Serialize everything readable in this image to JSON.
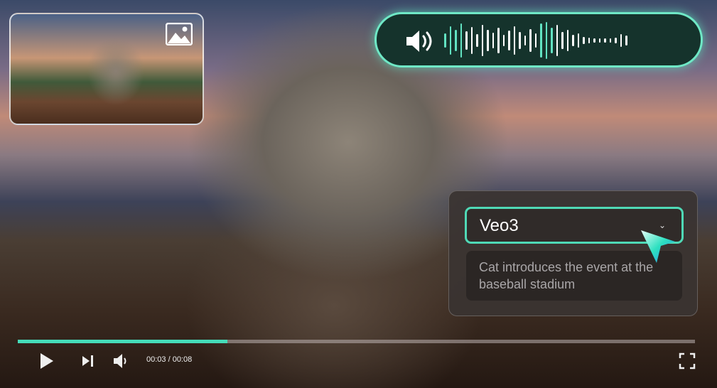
{
  "thumbnail": {
    "icon": "image-icon"
  },
  "audio": {
    "icon": "speaker-icon"
  },
  "model_panel": {
    "selected_model": "Veo3",
    "dropdown_icon": "chevron-down-icon",
    "prompt": "Cat introduces the event at the baseball stadium"
  },
  "player": {
    "progress": 0.31,
    "current_time": "00:03",
    "duration": "00:08",
    "time_display": "00:03 / 00:08",
    "accent": "#45dcb9"
  }
}
